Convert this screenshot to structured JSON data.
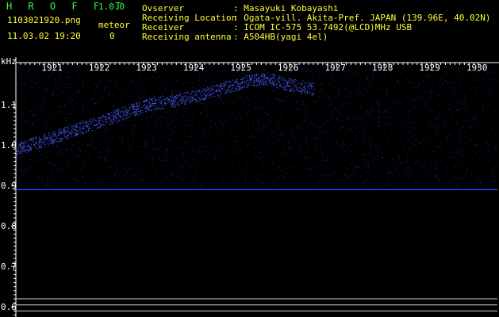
{
  "header": {
    "app_name": "H R O F F T",
    "version": "1.0.0",
    "filename": "1103021920.png",
    "meteor_label": "meteor",
    "datetime": "11.03.02 19:20",
    "meteor_count": "0"
  },
  "info": {
    "labels": [
      "Ovserver",
      "Receiving Location",
      "Receiver",
      "Receiving antenna"
    ],
    "values": [
      ": Masayuki Kobayashi",
      ": Ogata-vill. Akita-Pref. JAPAN (139.96E, 40.02N)",
      ": ICOM IC-575 53.7492(@LCD)MHz USB",
      ": A504HB(yagi 4el)"
    ]
  },
  "colors": {
    "background": "#000000",
    "header_text": "#ffff33",
    "title_text": "#39ff39",
    "axis": "#ffffff",
    "signal": "#3a4cff"
  },
  "chart_data": {
    "type": "heatmap",
    "y_unit_label": "kHz",
    "y_ticks": [
      "1.1",
      "1.0",
      "0.9",
      "0.8",
      "0.7",
      "0.6"
    ],
    "y_values": [
      1.1,
      1.0,
      0.9,
      0.8,
      0.7,
      0.6
    ],
    "x_ticks": [
      "1921",
      "1922",
      "1923",
      "1924",
      "1925",
      "1926",
      "1927",
      "1928",
      "1929",
      "1930"
    ],
    "ylim": [
      0.575,
      1.2
    ],
    "xlim": [
      1920.2,
      1930.4
    ],
    "carrier_band": {
      "from": 0.9,
      "to": 1.2
    },
    "constant_line_khz": 0.89,
    "reference_lines_khz": [
      0.62,
      0.605,
      0.59
    ],
    "drift_trace": [
      [
        1920.2,
        0.99
      ],
      [
        1921,
        1.02
      ],
      [
        1922,
        1.06
      ],
      [
        1923,
        1.1
      ],
      [
        1924,
        1.12
      ],
      [
        1925,
        1.155
      ],
      [
        1925.5,
        1.165
      ],
      [
        1926,
        1.15
      ],
      [
        1926.5,
        1.14
      ]
    ]
  }
}
